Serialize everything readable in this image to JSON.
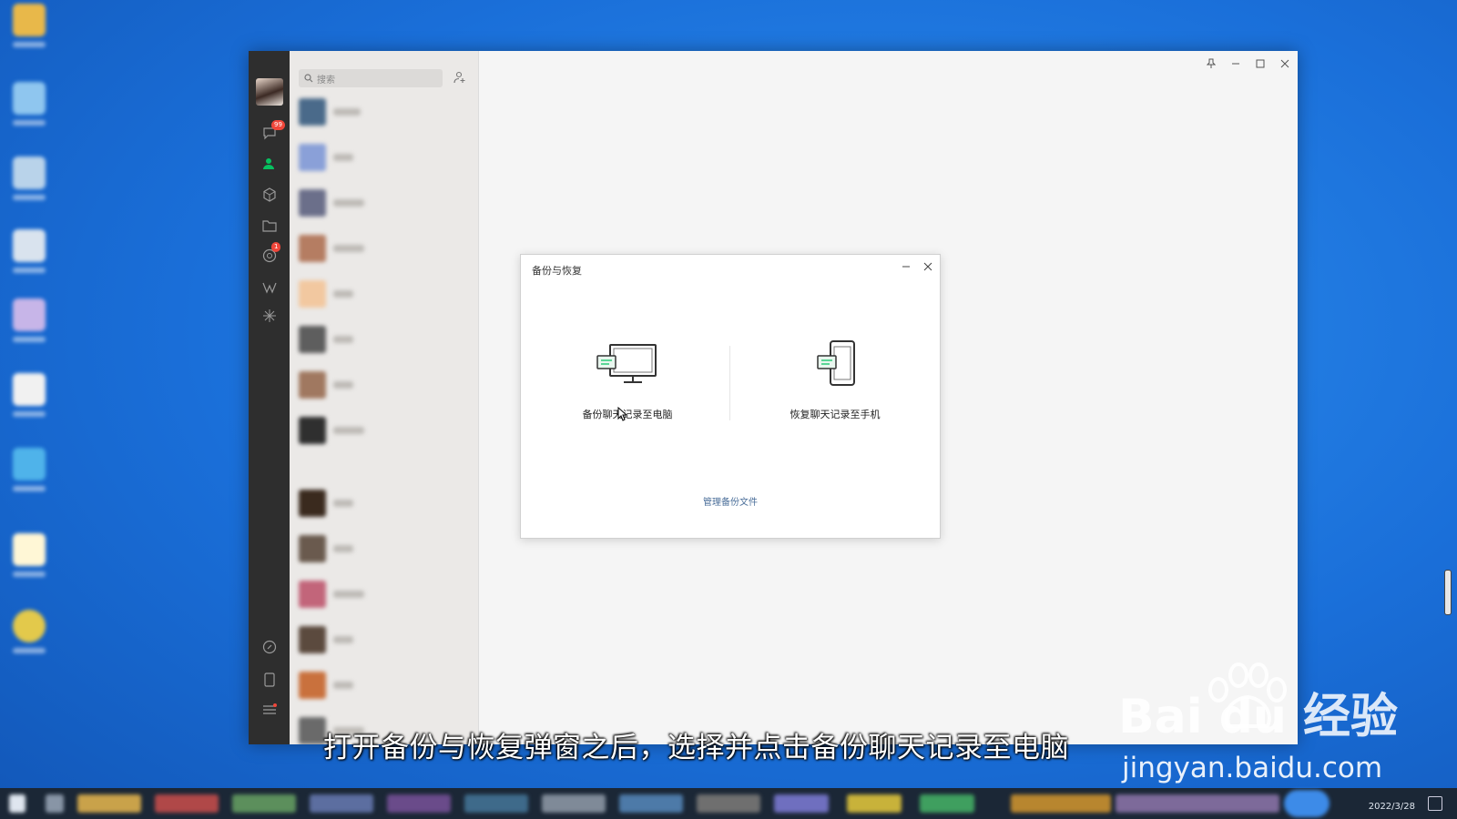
{
  "window": {
    "search_placeholder": "搜索",
    "sidebar_badges": {
      "chats": "99",
      "moments": "1"
    }
  },
  "dialog": {
    "title": "备份与恢复",
    "backup_to_pc_label": "备份聊天记录至电脑",
    "restore_to_phone_label": "恢复聊天记录至手机",
    "manage_link": "管理备份文件"
  },
  "overlay": {
    "subtitle": "打开备份与恢复弹窗之后，选择并点击备份聊天记录至电脑",
    "watermark_logo": "Bai du 经验",
    "watermark_url": "jingyan.baidu.com"
  },
  "taskbar": {
    "date": "2022/3/28"
  },
  "colors": {
    "accent_green": "#07c160",
    "badge_red": "#f0463a",
    "desktop_blue": "#1a6fd9",
    "link_blue": "#4a6e99"
  }
}
